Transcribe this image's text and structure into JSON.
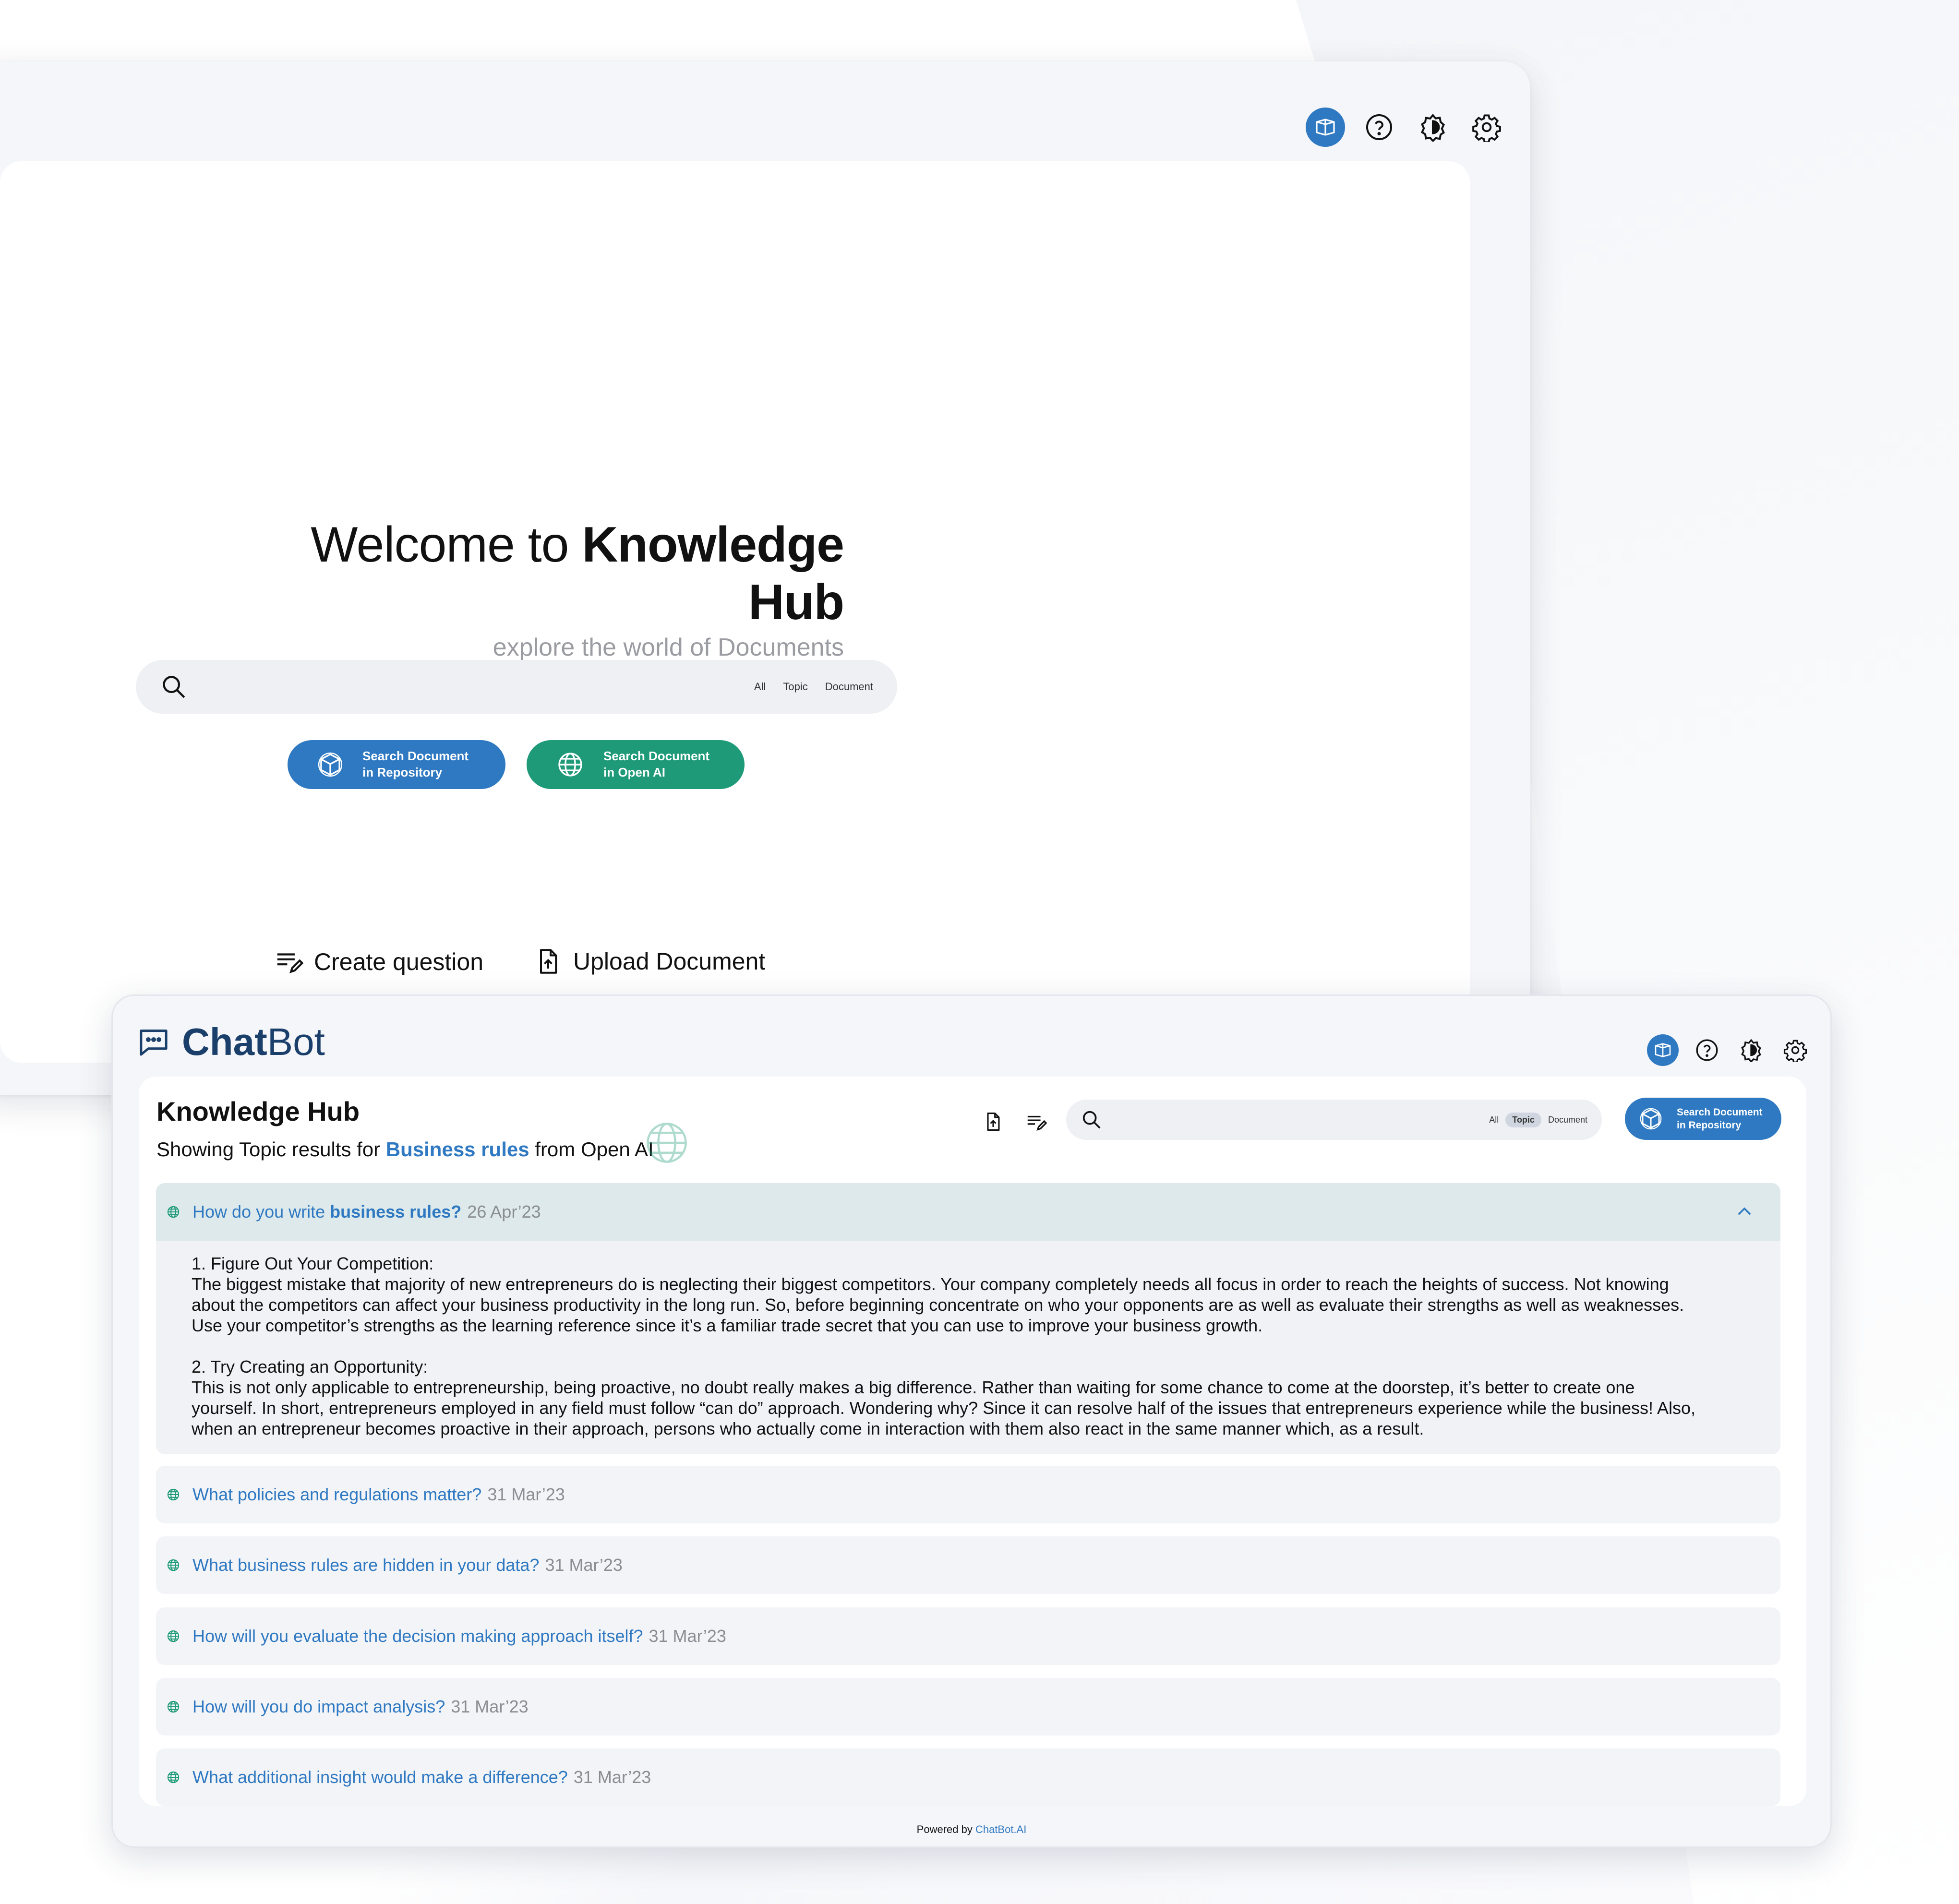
{
  "welcome_window": {
    "title_prefix": "Welcome to ",
    "title_bold": "Knowledge Hub",
    "subtitle": "explore the world of Documents",
    "search": {
      "placeholder": "",
      "filters": [
        "All",
        "Topic",
        "Document"
      ]
    },
    "buttons": {
      "repo_line1": "Search Document",
      "repo_line2": "in Repository",
      "openai_line1": "Search Document",
      "openai_line2": "in Open AI"
    },
    "actions": {
      "create_question": "Create question",
      "upload_document": "Upload Document"
    }
  },
  "chatbot": {
    "logo_bold": "Chat",
    "logo_regular": "Bot",
    "header_title": "Knowledge Hub",
    "subtitle_prefix": "Showing Topic results for ",
    "subtitle_highlight": "Business rules",
    "subtitle_suffix": " from Open AI",
    "search": {
      "placeholder": "",
      "filters": [
        "All",
        "Topic",
        "Document"
      ],
      "active_filter": "Topic"
    },
    "repo_button_line1": "Search Document",
    "repo_button_line2": "in Repository",
    "expanded": {
      "question_prefix": "How do you write ",
      "question_bold": "business rules?",
      "date": "26 Apr’23",
      "answer_1_title": "1. Figure Out Your Competition:",
      "answer_1_body": "The biggest mistake that majority of new entrepreneurs do is neglecting their biggest competitors. Your company completely needs all focus in order to reach the heights of success. Not knowing\nabout the competitors can affect your business productivity in the long run. So, before beginning concentrate on who your opponents are as well as evaluate their strengths as well as weaknesses.\nUse your competitor’s strengths as the learning reference since it’s a familiar trade secret that you can use to improve your business growth.",
      "answer_2_title": "2. Try Creating an Opportunity:",
      "answer_2_body": "This is not only applicable to entrepreneurship, being proactive, no doubt really makes a big difference. Rather than waiting for some chance to come at the doorstep, it’s better to create one\nyourself. In short, entrepreneurs employed in any field must follow “can do” approach. Wondering why? Since it can resolve half of the issues that entrepreneurs experience while the business! Also,\nwhen an entrepreneur becomes proactive in their approach, persons who actually come in interaction with them also react in the same manner which, as a result."
    },
    "questions": [
      {
        "text": "What policies and regulations matter?",
        "date": "31 Mar’23"
      },
      {
        "text": "What business rules are hidden in your data?",
        "date": "31 Mar’23"
      },
      {
        "text": "How will you evaluate the decision making approach itself?",
        "date": "31 Mar’23"
      },
      {
        "text": "How will you do impact analysis?",
        "date": "31 Mar’23"
      },
      {
        "text": "What additional insight would make a difference?",
        "date": "31 Mar’23"
      }
    ],
    "footer_prefix": "Powered by ",
    "footer_brand": "ChatBot.AI"
  },
  "colors": {
    "accent_blue": "#2f79c2",
    "accent_green": "#1e9a78",
    "brand_navy": "#1a3f6b",
    "expanded_header": "#dde9ea"
  },
  "icons": [
    "book-icon",
    "help-icon",
    "brightness-icon",
    "settings-icon",
    "search-icon",
    "cube-icon",
    "globe-icon",
    "edit-list-icon",
    "upload-file-icon",
    "chat-icon",
    "chevron-up-icon"
  ]
}
